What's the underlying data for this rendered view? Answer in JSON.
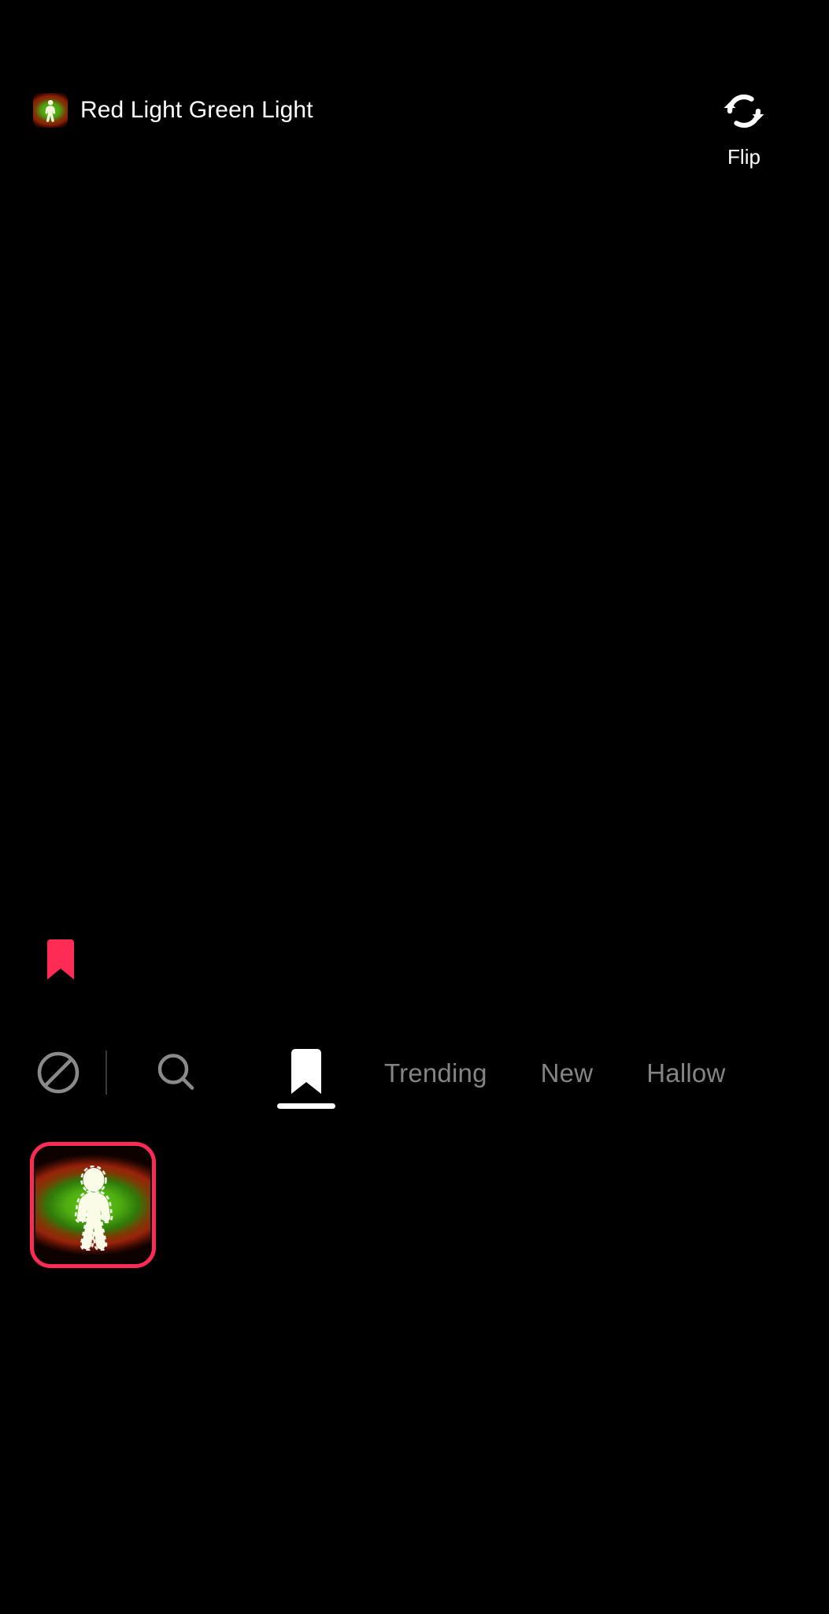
{
  "app": {
    "background_color": "#000000",
    "accent_color": "#fe2c55"
  },
  "header": {
    "effect_title": "Red Light Green Light",
    "effect_thumbnail_icon": "running-person-icon",
    "flip": {
      "label": "Flip",
      "icon": "rotate-refresh-icon"
    }
  },
  "camera": {
    "saved_indicator_icon": "bookmark-filled-icon",
    "saved_indicator_color": "#fe2c55"
  },
  "effect_panel": {
    "tabs": [
      {
        "id": "clear",
        "label": "",
        "icon": "no-effect-circle-slash-icon",
        "selected": false
      },
      {
        "id": "search",
        "label": "",
        "icon": "search-icon",
        "selected": false
      },
      {
        "id": "saved",
        "label": "",
        "icon": "bookmark-filled-icon",
        "selected": true
      },
      {
        "id": "trending",
        "label": "Trending",
        "icon": "",
        "selected": false
      },
      {
        "id": "new",
        "label": "New",
        "icon": "",
        "selected": false
      },
      {
        "id": "halloween",
        "label": "Hallow",
        "icon": "",
        "selected": false
      }
    ],
    "inactive_tab_color": "#848484",
    "active_tab_color": "#ffffff",
    "effects": [
      {
        "name": "Red Light Green Light",
        "icon": "running-person-icon",
        "selected": true,
        "selection_color": "#fe2c55"
      }
    ]
  }
}
